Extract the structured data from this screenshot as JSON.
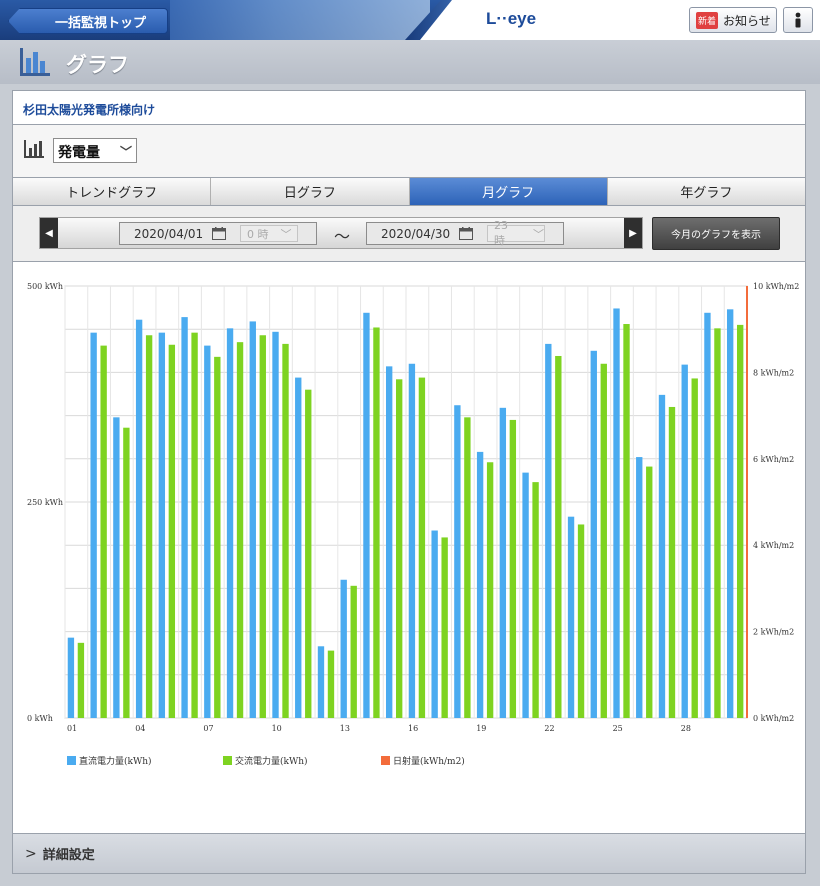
{
  "topbar": {
    "back_label": "一括監視トップ",
    "logo": "L··eye",
    "notice_badge": "新着",
    "notice_label": "お知らせ"
  },
  "header": {
    "title": "グラフ"
  },
  "site_name": "杉田太陽光発電所様向け",
  "metric_select": {
    "value": "発電量"
  },
  "tabs": [
    {
      "label": "トレンドグラフ",
      "active": false
    },
    {
      "label": "日グラフ",
      "active": false
    },
    {
      "label": "月グラフ",
      "active": true
    },
    {
      "label": "年グラフ",
      "active": false
    }
  ],
  "date_range": {
    "from_date": "2020/04/01",
    "from_hour": "0 時",
    "tilde": "〜",
    "to_date": "2020/04/30",
    "to_hour": "23 時",
    "this_month_label": "今月のグラフを表示"
  },
  "details_label": "詳細設定",
  "colors": {
    "dc": "#4aabf0",
    "ac": "#7ed321",
    "irr": "#f36c3b"
  },
  "chart_data": {
    "type": "bar",
    "x_tick_labels": [
      "01",
      "04",
      "07",
      "10",
      "13",
      "16",
      "19",
      "22",
      "25",
      "28"
    ],
    "x_tick_days": [
      1,
      4,
      7,
      10,
      13,
      16,
      19,
      22,
      25,
      28
    ],
    "days": [
      1,
      2,
      3,
      4,
      5,
      6,
      7,
      8,
      9,
      10,
      11,
      12,
      13,
      14,
      15,
      16,
      17,
      18,
      19,
      20,
      21,
      22,
      23,
      24,
      25,
      26,
      27,
      28,
      29,
      30
    ],
    "y_left": {
      "ticks": [
        "0 kWh",
        "250 kWh",
        "500 kWh"
      ],
      "tick_values": [
        0,
        250,
        500
      ],
      "ylim": [
        0,
        500
      ]
    },
    "y_right": {
      "ticks": [
        "0 kWh/m2",
        "2 kWh/m2",
        "4 kWh/m2",
        "6 kWh/m2",
        "8 kWh/m2",
        "10 kWh/m2"
      ],
      "tick_values": [
        0,
        2,
        4,
        6,
        8,
        10
      ],
      "ylim": [
        0,
        10
      ]
    },
    "grid": true,
    "legend_position": "bottom",
    "series": [
      {
        "name": "直流電力量(kWh)",
        "axis": "left",
        "values": [
          93,
          446,
          348,
          461,
          446,
          464,
          431,
          451,
          459,
          447,
          394,
          83,
          160,
          469,
          407,
          410,
          217,
          362,
          308,
          359,
          284,
          433,
          233,
          425,
          474,
          302,
          374,
          409,
          469,
          473
        ]
      },
      {
        "name": "交流電力量(kWh)",
        "axis": "left",
        "values": [
          87,
          431,
          336,
          443,
          432,
          446,
          418,
          435,
          443,
          433,
          380,
          78,
          153,
          452,
          392,
          394,
          209,
          348,
          296,
          345,
          273,
          419,
          224,
          410,
          456,
          291,
          360,
          393,
          451,
          455
        ]
      },
      {
        "name": "日射量(kWh/m2)",
        "axis": "right",
        "values": []
      }
    ]
  }
}
